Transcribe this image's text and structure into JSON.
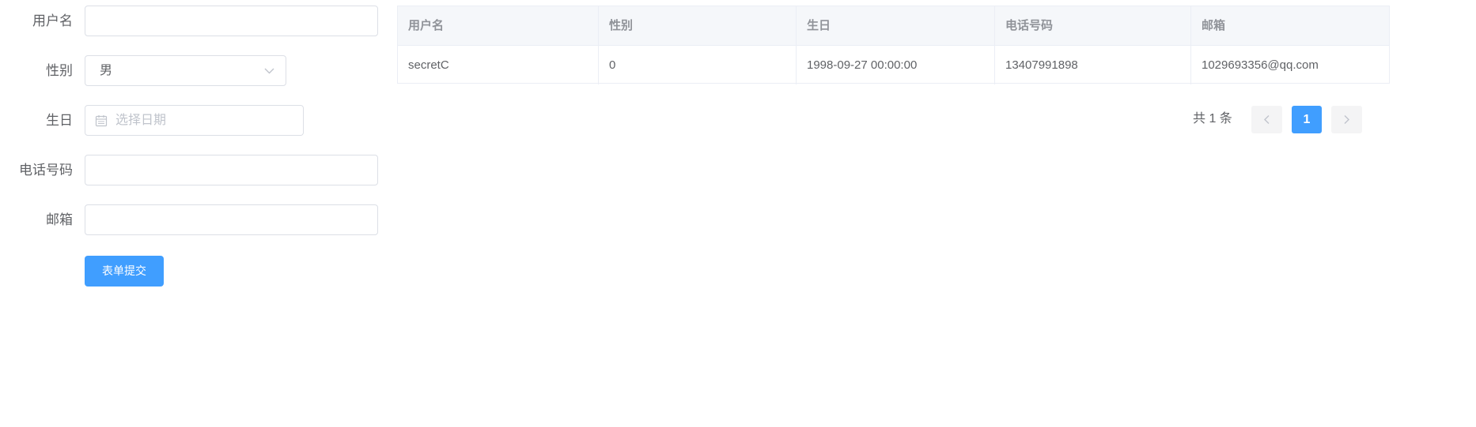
{
  "form": {
    "username": {
      "label": "用户名",
      "value": ""
    },
    "gender": {
      "label": "性别",
      "value": "男"
    },
    "birthday": {
      "label": "生日",
      "placeholder": "选择日期"
    },
    "phone": {
      "label": "电话号码",
      "value": ""
    },
    "email": {
      "label": "邮箱",
      "value": ""
    },
    "submit_label": "表单提交"
  },
  "table": {
    "headers": [
      "用户名",
      "性别",
      "生日",
      "电话号码",
      "邮箱"
    ],
    "rows": [
      [
        "secretC",
        "0",
        "1998-09-27 00:00:00",
        "13407991898",
        "1029693356@qq.com"
      ]
    ]
  },
  "pagination": {
    "total_text": "共 1 条",
    "current_page": "1"
  },
  "colors": {
    "primary": "#409eff",
    "border": "#dcdfe6",
    "header_bg": "#f5f7fa"
  },
  "icons": {
    "chevron": "chevron-down-icon",
    "calendar": "calendar-icon",
    "prev": "chevron-left-icon",
    "next": "chevron-right-icon"
  }
}
